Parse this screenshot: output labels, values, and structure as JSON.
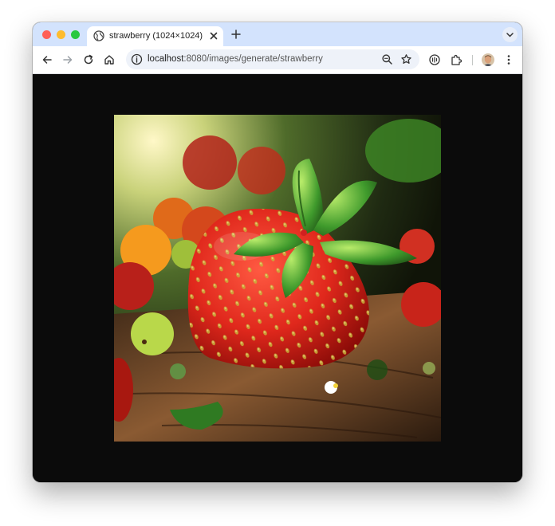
{
  "tab": {
    "title": "strawberry (1024×1024)"
  },
  "address_bar": {
    "host": "localhost",
    "path": ":8080/images/generate/strawberry"
  },
  "image": {
    "alt": "strawberry"
  },
  "colors": {
    "tab_strip": "#d3e3fd",
    "page_background": "#0b0b0b",
    "strawberry_red": "#e0281c",
    "leaf_green": "#3f9a2c"
  },
  "icons": {
    "back": "arrow-left-icon",
    "forward": "arrow-right-icon",
    "reload": "reload-icon",
    "home": "home-icon",
    "site_info": "info-icon",
    "zoom": "zoom-icon",
    "bookmark": "star-icon",
    "media": "media-icon",
    "extensions": "puzzle-icon",
    "menu": "kebab-menu-icon"
  }
}
